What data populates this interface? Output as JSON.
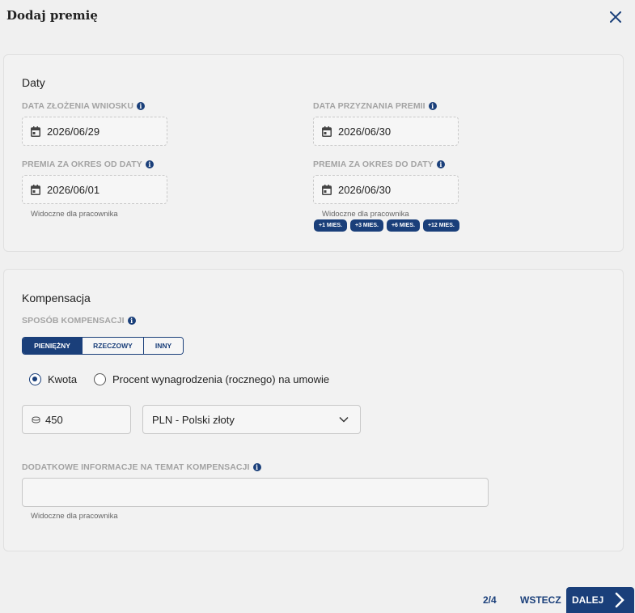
{
  "dialog": {
    "title": "Dodaj premię",
    "close_icon": "close-icon"
  },
  "dates": {
    "section_title": "Daty",
    "submission": {
      "label": "DATA ZŁOŻENIA WNIOSKU",
      "value": "2026/06/29"
    },
    "granted": {
      "label": "DATA PRZYZNANIA PREMII",
      "value": "2026/06/30"
    },
    "period_from": {
      "label": "PREMIA ZA OKRES OD DATY",
      "value": "2026/06/01",
      "hint": "Widoczne dla pracownika"
    },
    "period_to": {
      "label": "PREMIA ZA OKRES DO DATY",
      "value": "2026/06/30",
      "hint": "Widoczne dla pracownika"
    },
    "quick_ranges": [
      "+1 MIES.",
      "+3 MIES.",
      "+6 MIES.",
      "+12 MIES."
    ]
  },
  "compensation": {
    "section_title": "Kompensacja",
    "method_label": "SPOSÓB KOMPENSACJI",
    "methods": [
      "PIENIĘŻNY",
      "RZECZOWY",
      "INNY"
    ],
    "selected_method": "PIENIĘŻNY",
    "radio_options": [
      "Kwota",
      "Procent wynagrodzenia (rocznego) na umowie"
    ],
    "selected_radio": "Kwota",
    "amount": "450",
    "currency": "PLN - Polski złoty",
    "extra_info_label": "DODATKOWE INFORMACJE NA TEMAT KOMPENSACJI",
    "extra_info_value": "",
    "extra_info_hint": "Widoczne dla pracownika"
  },
  "footer": {
    "step": "2/4",
    "back_label": "WSTECZ",
    "next_label": "DALEJ"
  },
  "colors": {
    "accent": "#1a3f7a",
    "label": "#a3a3a3",
    "background": "#f0f0f0"
  }
}
